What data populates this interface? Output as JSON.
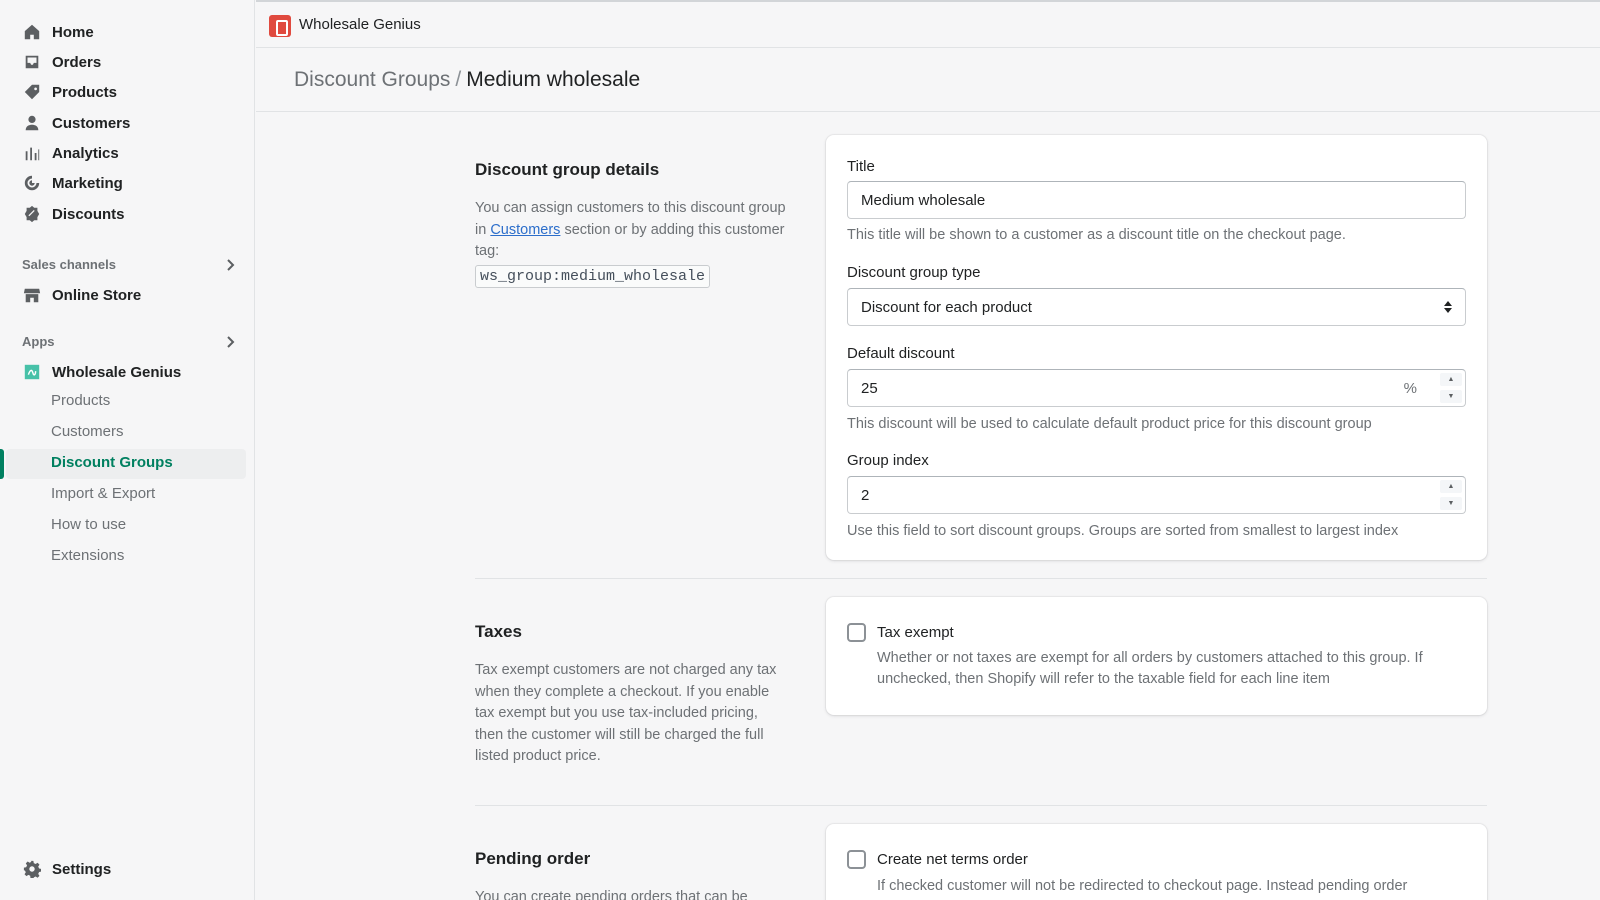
{
  "sidebar": {
    "nav": [
      {
        "label": "Home",
        "icon": "home-icon"
      },
      {
        "label": "Orders",
        "icon": "orders-icon"
      },
      {
        "label": "Products",
        "icon": "tag-icon"
      },
      {
        "label": "Customers",
        "icon": "person-icon"
      },
      {
        "label": "Analytics",
        "icon": "bar-chart-icon"
      },
      {
        "label": "Marketing",
        "icon": "marketing-icon"
      },
      {
        "label": "Discounts",
        "icon": "discount-icon"
      }
    ],
    "sales_channels_label": "Sales channels",
    "online_store": "Online Store",
    "apps_label": "Apps",
    "app_name": "Wholesale Genius",
    "app_items": [
      "Products",
      "Customers",
      "Discount Groups",
      "Import & Export",
      "How to use",
      "Extensions"
    ],
    "active_app_item": "Discount Groups",
    "settings": "Settings"
  },
  "topbar": {
    "app_name": "Wholesale Genius"
  },
  "header": {
    "breadcrumb_parent": "Discount Groups",
    "separator": "/",
    "title": "Medium wholesale"
  },
  "details": {
    "title": "Discount group details",
    "desc_before": "You can assign customers to this discount group in ",
    "desc_link": "Customers",
    "desc_after": " section or by adding this customer tag:",
    "tag": "ws_group:medium_wholesale"
  },
  "form": {
    "title_label": "Title",
    "title_value": "Medium wholesale",
    "title_help": "This title will be shown to a customer as a discount title on the checkout page.",
    "type_label": "Discount group type",
    "type_value": "Discount for each product",
    "discount_label": "Default discount",
    "discount_value": "25",
    "discount_suffix": "%",
    "discount_help": "This discount will be used to calculate default product price for this discount group",
    "index_label": "Group index",
    "index_value": "2",
    "index_help": "Use this field to sort discount groups. Groups are sorted from smallest to largest index"
  },
  "taxes": {
    "title": "Taxes",
    "desc": "Tax exempt customers are not charged any tax when they complete a checkout. If you enable tax exempt but you use tax-included pricing, then the customer will still be charged the full listed product price.",
    "checkbox_label": "Tax exempt",
    "checkbox_help": "Whether or not taxes are exempt for all orders by customers attached to this group. If unchecked, then Shopify will refer to the taxable field for each line item",
    "checked": false
  },
  "pending": {
    "title": "Pending order",
    "desc": "You can create pending orders that can be",
    "checkbox_label": "Create net terms order",
    "checkbox_help": "If checked customer will not be redirected to checkout page. Instead pending order",
    "checked": false
  },
  "colors": {
    "accent": "#008060",
    "link": "#2c6ecb",
    "logo": "#e04a3f"
  }
}
